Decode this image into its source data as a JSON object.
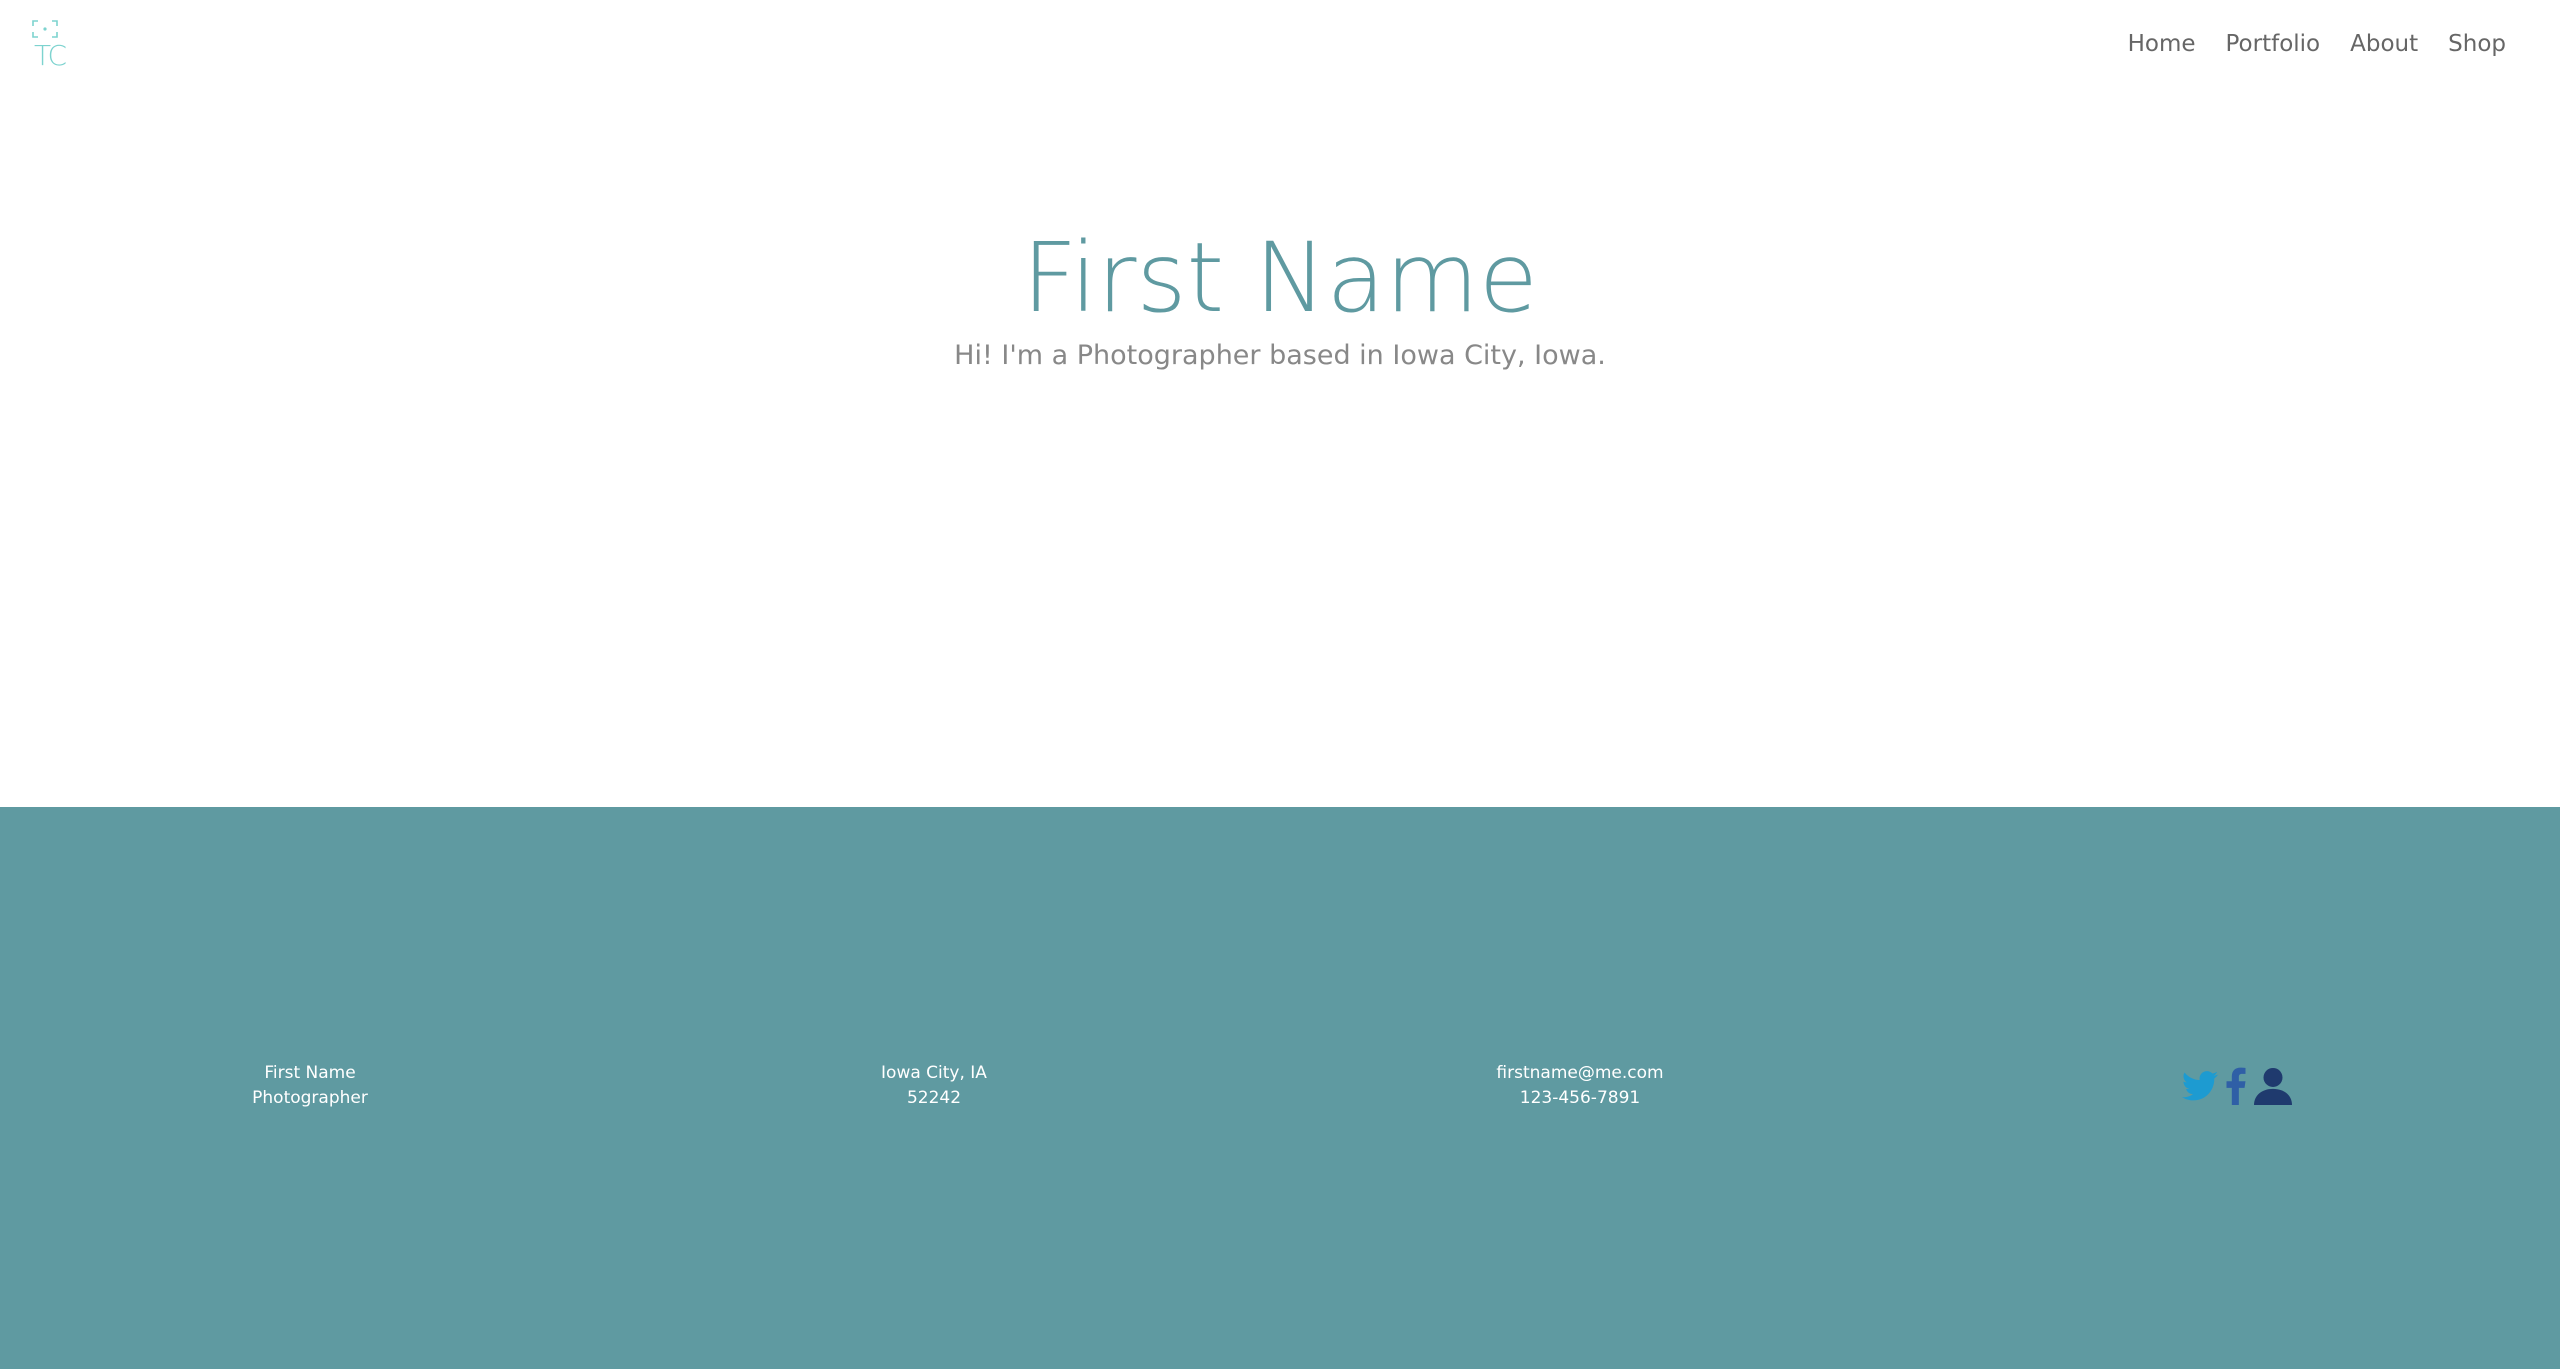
{
  "header": {
    "logo_text": "TC",
    "nav": [
      {
        "label": "Home"
      },
      {
        "label": "Portfolio"
      },
      {
        "label": "About"
      },
      {
        "label": "Shop"
      }
    ]
  },
  "hero": {
    "title": "First Name",
    "subtitle": "Hi! I'm a Photographer based in Iowa City, Iowa."
  },
  "footer": {
    "name": "First Name",
    "role": "Photographer",
    "city": "Iowa City, IA",
    "zip": "52242",
    "email": "firstname@me.com",
    "phone": "123-456-7891",
    "social_icons": [
      "twitter-icon",
      "facebook-icon",
      "user-profile-icon"
    ]
  },
  "colors": {
    "accent": "#5f9aa1",
    "logo": "#7dd3cf",
    "twitter": "#1d9bd1",
    "facebook": "#2f5fa6",
    "profile": "#1f3a6e"
  }
}
